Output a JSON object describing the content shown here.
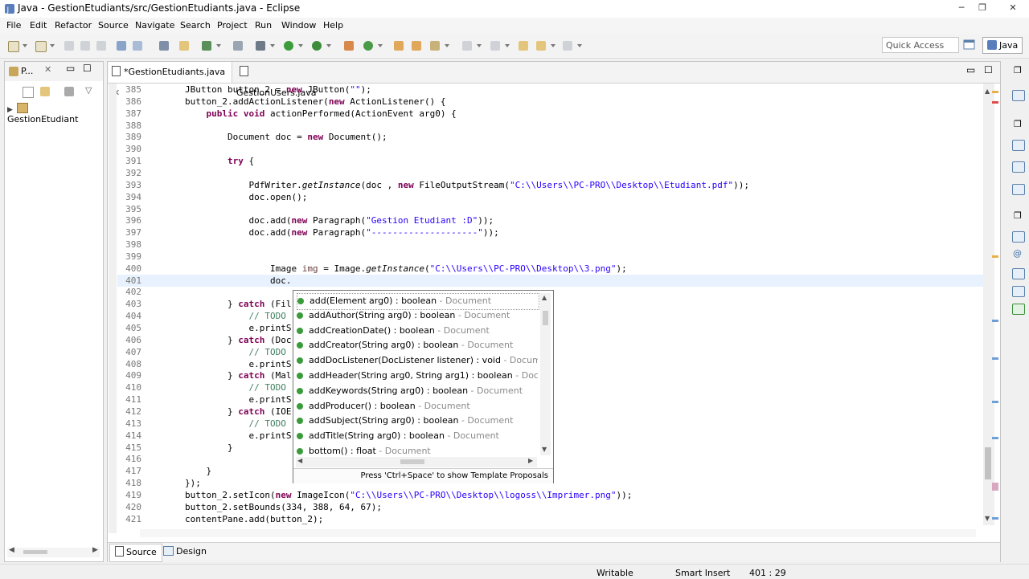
{
  "window": {
    "title": "Java - GestionEtudiants/src/GestionEtudiants.java - Eclipse",
    "minimize": "─",
    "maximize": "❐",
    "close": "✕"
  },
  "menu": [
    "File",
    "Edit",
    "Refactor",
    "Source",
    "Navigate",
    "Search",
    "Project",
    "Run",
    "Window",
    "Help"
  ],
  "toolbar": {
    "quick_access_placeholder": "Quick Access",
    "perspective": "Java"
  },
  "explorer": {
    "tab_label": "P...",
    "project": "GestionEtudiant"
  },
  "editor": {
    "tabs": [
      {
        "label": "*GestionEtudiants.java",
        "active": true
      },
      {
        "label": "GestionUsers.java",
        "active": false
      }
    ],
    "lines": [
      {
        "n": "385",
        "text": "JButton button_2 = new JButton(\"\");"
      },
      {
        "n": "386",
        "text": "button_2.addActionListener(new ActionListener() {"
      },
      {
        "n": "387",
        "text": "    public void actionPerformed(ActionEvent arg0) {"
      },
      {
        "n": "388",
        "text": ""
      },
      {
        "n": "389",
        "text": "        Document doc = new Document();"
      },
      {
        "n": "390",
        "text": ""
      },
      {
        "n": "391",
        "text": "        try {"
      },
      {
        "n": "392",
        "text": ""
      },
      {
        "n": "393",
        "text": "            PdfWriter.getInstance(doc , new FileOutputStream(\"C:\\\\Users\\\\PC-PRO\\\\Desktop\\\\Etudiant.pdf\"));"
      },
      {
        "n": "394",
        "text": "            doc.open();"
      },
      {
        "n": "395",
        "text": ""
      },
      {
        "n": "396",
        "text": "            doc.add(new Paragraph(\"Gestion Etudiant :D\"));"
      },
      {
        "n": "397",
        "text": "            doc.add(new Paragraph(\"--------------------\"));"
      },
      {
        "n": "398",
        "text": ""
      },
      {
        "n": "399",
        "text": ""
      },
      {
        "n": "400",
        "text": "                Image img = Image.getInstance(\"C:\\\\Users\\\\PC-PRO\\\\Desktop\\\\3.png\");"
      },
      {
        "n": "401",
        "text": "                doc."
      },
      {
        "n": "402",
        "text": ""
      },
      {
        "n": "403",
        "text": "        } catch (Fil"
      },
      {
        "n": "404",
        "text": "            // TODO"
      },
      {
        "n": "405",
        "text": "            e.printS"
      },
      {
        "n": "406",
        "text": "        } catch (Doc"
      },
      {
        "n": "407",
        "text": "            // TODO"
      },
      {
        "n": "408",
        "text": "            e.printS"
      },
      {
        "n": "409",
        "text": "        } catch (Mal"
      },
      {
        "n": "410",
        "text": "            // TODO"
      },
      {
        "n": "411",
        "text": "            e.printS"
      },
      {
        "n": "412",
        "text": "        } catch (IOE"
      },
      {
        "n": "413",
        "text": "            // TODO"
      },
      {
        "n": "414",
        "text": "            e.printS"
      },
      {
        "n": "415",
        "text": "        }"
      },
      {
        "n": "416",
        "text": ""
      },
      {
        "n": "417",
        "text": "    }"
      },
      {
        "n": "418",
        "text": "});"
      },
      {
        "n": "419",
        "text": "button_2.setIcon(new ImageIcon(\"C:\\\\Users\\\\PC-PRO\\\\Desktop\\\\logoss\\\\Imprimer.png\"));"
      },
      {
        "n": "420",
        "text": "button_2.setBounds(334, 388, 64, 67);"
      },
      {
        "n": "421",
        "text": "contentPane.add(button_2);"
      }
    ],
    "bottom_tabs": [
      "Source",
      "Design"
    ]
  },
  "autocomplete": {
    "proposals": [
      {
        "sig": "add(Element arg0) : boolean",
        "type": " - Document"
      },
      {
        "sig": "addAuthor(String arg0) : boolean",
        "type": " - Document"
      },
      {
        "sig": "addCreationDate() : boolean",
        "type": " - Document"
      },
      {
        "sig": "addCreator(String arg0) : boolean",
        "type": " - Document"
      },
      {
        "sig": "addDocListener(DocListener listener) : void",
        "type": " - Document"
      },
      {
        "sig": "addHeader(String arg0, String arg1) : boolean",
        "type": " - Document"
      },
      {
        "sig": "addKeywords(String arg0) : boolean",
        "type": " - Document"
      },
      {
        "sig": "addProducer() : boolean",
        "type": " - Document"
      },
      {
        "sig": "addSubject(String arg0) : boolean",
        "type": " - Document"
      },
      {
        "sig": "addTitle(String arg0) : boolean",
        "type": " - Document"
      },
      {
        "sig": "bottom() : float",
        "type": " - Document"
      }
    ],
    "hint": "Press 'Ctrl+Space' to show Template Proposals"
  },
  "status": {
    "writable": "Writable",
    "insert_mode": "Smart Insert",
    "position": "401 : 29"
  }
}
